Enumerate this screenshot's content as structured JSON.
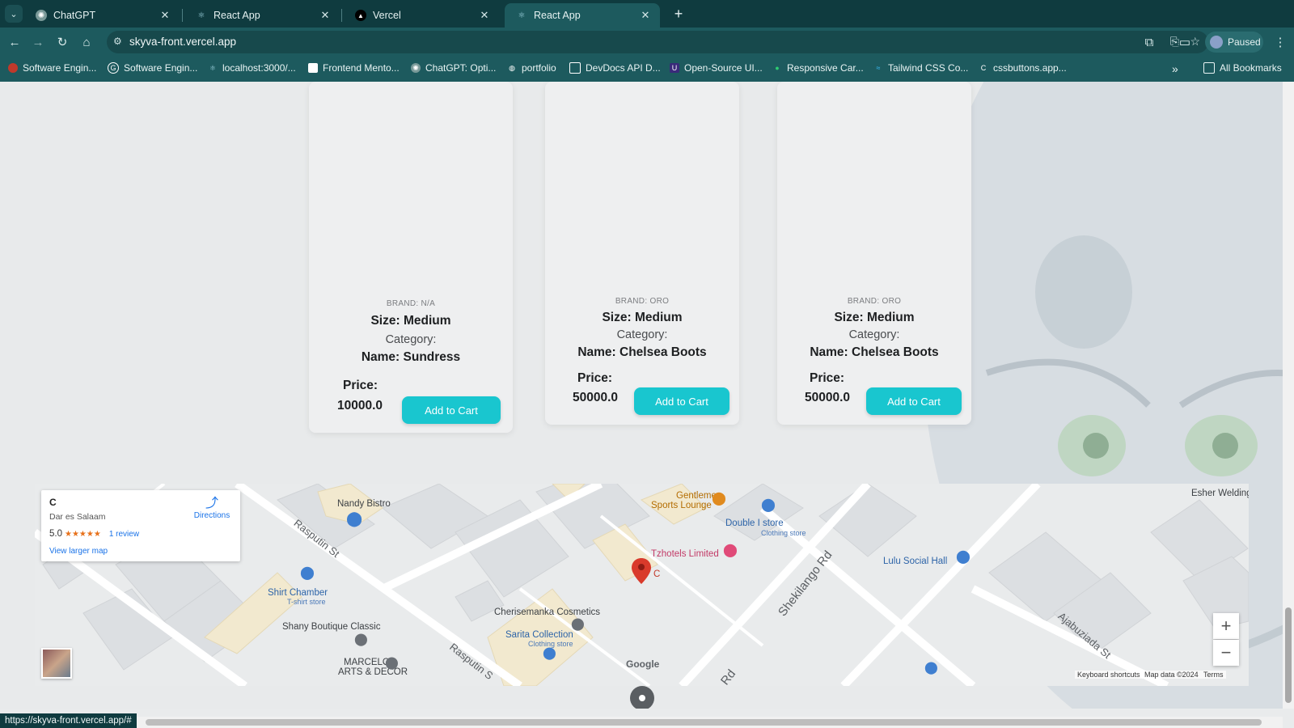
{
  "browser": {
    "tabs": [
      {
        "title": "ChatGPT",
        "active": false
      },
      {
        "title": "React App",
        "active": false
      },
      {
        "title": "Vercel",
        "active": false
      },
      {
        "title": "React App",
        "active": true
      }
    ],
    "url": "skyva-front.vercel.app",
    "profile_label": "Paused",
    "bookmarks": [
      "Software Engin...",
      "Software Engin...",
      "localhost:3000/...",
      "Frontend Mento...",
      "ChatGPT: Opti...",
      "portfolio",
      "DevDocs API D...",
      "Open-Source UI...",
      "Responsive Car...",
      "Tailwind CSS Co...",
      "cssbuttons.app..."
    ],
    "all_bookmarks": "All Bookmarks",
    "status_url": "https://skyva-front.vercel.app/#"
  },
  "products": [
    {
      "brand": "BRAND: N/A",
      "size": "Size: Medium",
      "category": "Category:",
      "name": "Name: Sundress",
      "price_label": "Price:",
      "price": "10000.0",
      "button": "Add to Cart"
    },
    {
      "brand": "BRAND: ORO",
      "size": "Size: Medium",
      "category": "Category:",
      "name": "Name: Chelsea Boots",
      "price_label": "Price:",
      "price": "50000.0",
      "button": "Add to Cart"
    },
    {
      "brand": "BRAND: ORO",
      "size": "Size: Medium",
      "category": "Category:",
      "name": "Name: Chelsea Boots",
      "price_label": "Price:",
      "price": "50000.0",
      "button": "Add to Cart"
    }
  ],
  "map": {
    "place_title": "C",
    "place_city": "Dar es Salaam",
    "rating": "5.0",
    "stars": "★★★★★",
    "reviews": "1 review",
    "directions": "Directions",
    "larger_map": "View larger map",
    "pin_label": "C",
    "labels": {
      "nandy": "Nandy Bistro",
      "gentlemen": "Gentlemen",
      "sports": "Sports Lounge",
      "double": "Double I store",
      "double_sub": "Clothing store",
      "tzhotels": "Tzhotels Limited",
      "lulu": "Lulu Social Hall",
      "esher": "Esher Welding",
      "shirt": "Shirt Chamber",
      "shirt_sub": "T-shirt store",
      "shany": "Shany Boutique Classic",
      "marcelo1": "MARCELO",
      "marcelo2": "ARTS & DECOR",
      "cherise": "Cherisemanka Cosmetics",
      "sarita": "Sarita Collection",
      "sarita_sub": "Clothing store"
    },
    "roads": {
      "rasputin1": "Rasputin St",
      "rasputin2": "Rasputin S",
      "shekilango": "Shekilango Rd",
      "ajabuziada": "Ajabuziada St",
      "rd": "Rd"
    },
    "google": "Google",
    "keyboard": "Keyboard shortcuts",
    "mapdata": "Map data ©2024",
    "terms": "Terms"
  }
}
